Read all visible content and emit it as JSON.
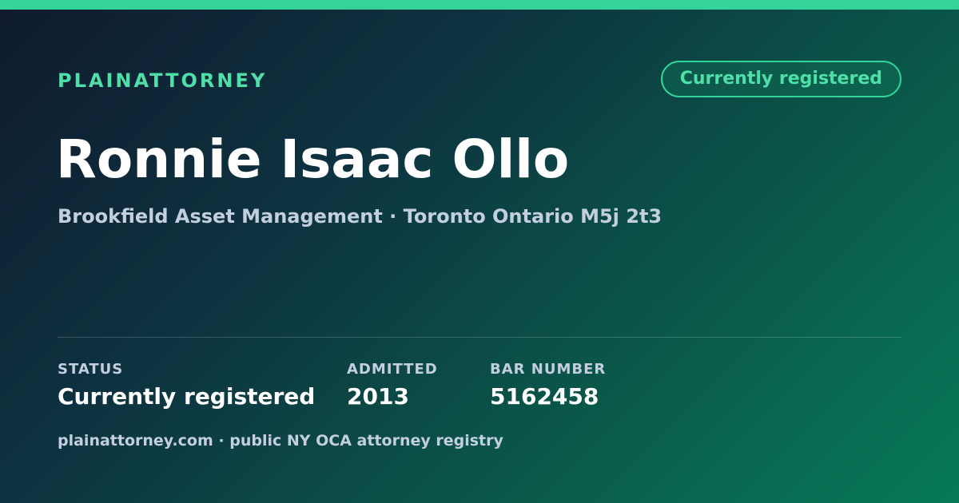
{
  "brand": "PLAINATTORNEY",
  "status_badge": "Currently registered",
  "attorney": {
    "name": "Ronnie Isaac Ollo",
    "subtitle": "Brookfield Asset Management · Toronto Ontario M5j 2t3"
  },
  "stats": {
    "status": {
      "label": "STATUS",
      "value": "Currently registered"
    },
    "admitted": {
      "label": "ADMITTED",
      "value": "2013"
    },
    "bar_number": {
      "label": "BAR NUMBER",
      "value": "5162458"
    }
  },
  "footer": "plainattorney.com · public NY OCA attorney registry",
  "colors": {
    "accent": "#34d399",
    "brand_text": "#4ee0a8",
    "muted_text": "#c3cfe0",
    "background_start": "#101a2e",
    "background_end": "#077a58"
  }
}
